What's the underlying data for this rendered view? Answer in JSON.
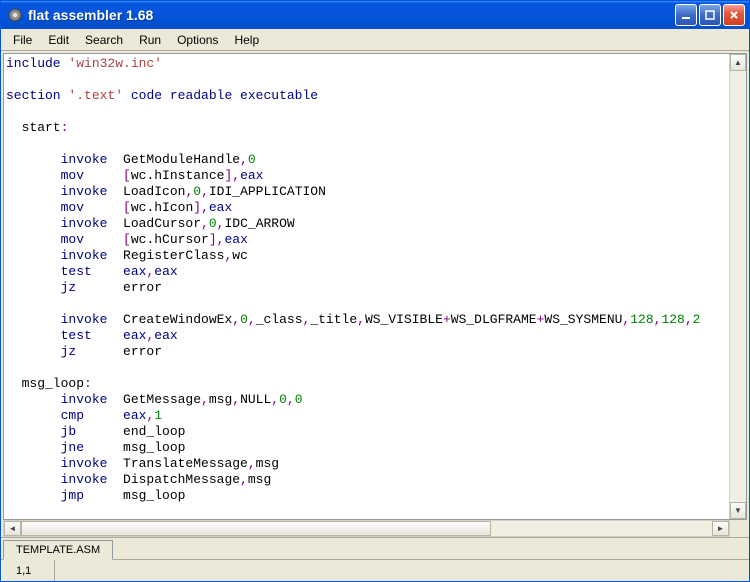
{
  "window": {
    "title": "flat assembler 1.68"
  },
  "menu": {
    "file": "File",
    "edit": "Edit",
    "search": "Search",
    "run": "Run",
    "options": "Options",
    "help": "Help"
  },
  "tab": {
    "filename": "TEMPLATE.ASM"
  },
  "status": {
    "position": "1,1"
  },
  "code": {
    "lines": [
      {
        "t": "kw",
        "v": "include "
      },
      {
        "t": "str",
        "v": "'win32w.inc'"
      },
      {
        "t": "nl"
      },
      {
        "t": "nl"
      },
      {
        "t": "kw",
        "v": "section "
      },
      {
        "t": "str",
        "v": "'.text' "
      },
      {
        "t": "kw",
        "v": "code readable executable"
      },
      {
        "t": "nl"
      },
      {
        "t": "nl"
      },
      {
        "t": "txt",
        "v": "  start"
      },
      {
        "t": "op",
        "v": ":"
      },
      {
        "t": "nl"
      },
      {
        "t": "nl"
      },
      {
        "t": "txt",
        "v": "       "
      },
      {
        "t": "kw",
        "v": "invoke"
      },
      {
        "t": "txt",
        "v": "  GetModuleHandle"
      },
      {
        "t": "op",
        "v": ","
      },
      {
        "t": "num",
        "v": "0"
      },
      {
        "t": "nl"
      },
      {
        "t": "txt",
        "v": "       "
      },
      {
        "t": "kw",
        "v": "mov"
      },
      {
        "t": "txt",
        "v": "     "
      },
      {
        "t": "op",
        "v": "["
      },
      {
        "t": "txt",
        "v": "wc.hInstance"
      },
      {
        "t": "op",
        "v": "],"
      },
      {
        "t": "kw",
        "v": "eax"
      },
      {
        "t": "nl"
      },
      {
        "t": "txt",
        "v": "       "
      },
      {
        "t": "kw",
        "v": "invoke"
      },
      {
        "t": "txt",
        "v": "  LoadIcon"
      },
      {
        "t": "op",
        "v": ","
      },
      {
        "t": "num",
        "v": "0"
      },
      {
        "t": "op",
        "v": ","
      },
      {
        "t": "txt",
        "v": "IDI_APPLICATION"
      },
      {
        "t": "nl"
      },
      {
        "t": "txt",
        "v": "       "
      },
      {
        "t": "kw",
        "v": "mov"
      },
      {
        "t": "txt",
        "v": "     "
      },
      {
        "t": "op",
        "v": "["
      },
      {
        "t": "txt",
        "v": "wc.hIcon"
      },
      {
        "t": "op",
        "v": "],"
      },
      {
        "t": "kw",
        "v": "eax"
      },
      {
        "t": "nl"
      },
      {
        "t": "txt",
        "v": "       "
      },
      {
        "t": "kw",
        "v": "invoke"
      },
      {
        "t": "txt",
        "v": "  LoadCursor"
      },
      {
        "t": "op",
        "v": ","
      },
      {
        "t": "num",
        "v": "0"
      },
      {
        "t": "op",
        "v": ","
      },
      {
        "t": "txt",
        "v": "IDC_ARROW"
      },
      {
        "t": "nl"
      },
      {
        "t": "txt",
        "v": "       "
      },
      {
        "t": "kw",
        "v": "mov"
      },
      {
        "t": "txt",
        "v": "     "
      },
      {
        "t": "op",
        "v": "["
      },
      {
        "t": "txt",
        "v": "wc.hCursor"
      },
      {
        "t": "op",
        "v": "],"
      },
      {
        "t": "kw",
        "v": "eax"
      },
      {
        "t": "nl"
      },
      {
        "t": "txt",
        "v": "       "
      },
      {
        "t": "kw",
        "v": "invoke"
      },
      {
        "t": "txt",
        "v": "  RegisterClass"
      },
      {
        "t": "op",
        "v": ","
      },
      {
        "t": "txt",
        "v": "wc"
      },
      {
        "t": "nl"
      },
      {
        "t": "txt",
        "v": "       "
      },
      {
        "t": "kw",
        "v": "test"
      },
      {
        "t": "txt",
        "v": "    "
      },
      {
        "t": "kw",
        "v": "eax"
      },
      {
        "t": "op",
        "v": ","
      },
      {
        "t": "kw",
        "v": "eax"
      },
      {
        "t": "nl"
      },
      {
        "t": "txt",
        "v": "       "
      },
      {
        "t": "kw",
        "v": "jz"
      },
      {
        "t": "txt",
        "v": "      error"
      },
      {
        "t": "nl"
      },
      {
        "t": "nl"
      },
      {
        "t": "txt",
        "v": "       "
      },
      {
        "t": "kw",
        "v": "invoke"
      },
      {
        "t": "txt",
        "v": "  CreateWindowEx"
      },
      {
        "t": "op",
        "v": ","
      },
      {
        "t": "num",
        "v": "0"
      },
      {
        "t": "op",
        "v": ","
      },
      {
        "t": "txt",
        "v": "_class"
      },
      {
        "t": "op",
        "v": ","
      },
      {
        "t": "txt",
        "v": "_title"
      },
      {
        "t": "op",
        "v": ","
      },
      {
        "t": "txt",
        "v": "WS_VISIBLE"
      },
      {
        "t": "op",
        "v": "+"
      },
      {
        "t": "txt",
        "v": "WS_DLGFRAME"
      },
      {
        "t": "op",
        "v": "+"
      },
      {
        "t": "txt",
        "v": "WS_SYSMENU"
      },
      {
        "t": "op",
        "v": ","
      },
      {
        "t": "num",
        "v": "128"
      },
      {
        "t": "op",
        "v": ","
      },
      {
        "t": "num",
        "v": "128"
      },
      {
        "t": "op",
        "v": ","
      },
      {
        "t": "num",
        "v": "2"
      },
      {
        "t": "nl"
      },
      {
        "t": "txt",
        "v": "       "
      },
      {
        "t": "kw",
        "v": "test"
      },
      {
        "t": "txt",
        "v": "    "
      },
      {
        "t": "kw",
        "v": "eax"
      },
      {
        "t": "op",
        "v": ","
      },
      {
        "t": "kw",
        "v": "eax"
      },
      {
        "t": "nl"
      },
      {
        "t": "txt",
        "v": "       "
      },
      {
        "t": "kw",
        "v": "jz"
      },
      {
        "t": "txt",
        "v": "      error"
      },
      {
        "t": "nl"
      },
      {
        "t": "nl"
      },
      {
        "t": "txt",
        "v": "  msg_loop"
      },
      {
        "t": "op",
        "v": ":"
      },
      {
        "t": "nl"
      },
      {
        "t": "txt",
        "v": "       "
      },
      {
        "t": "kw",
        "v": "invoke"
      },
      {
        "t": "txt",
        "v": "  GetMessage"
      },
      {
        "t": "op",
        "v": ","
      },
      {
        "t": "txt",
        "v": "msg"
      },
      {
        "t": "op",
        "v": ","
      },
      {
        "t": "txt",
        "v": "NULL"
      },
      {
        "t": "op",
        "v": ","
      },
      {
        "t": "num",
        "v": "0"
      },
      {
        "t": "op",
        "v": ","
      },
      {
        "t": "num",
        "v": "0"
      },
      {
        "t": "nl"
      },
      {
        "t": "txt",
        "v": "       "
      },
      {
        "t": "kw",
        "v": "cmp"
      },
      {
        "t": "txt",
        "v": "     "
      },
      {
        "t": "kw",
        "v": "eax"
      },
      {
        "t": "op",
        "v": ","
      },
      {
        "t": "num",
        "v": "1"
      },
      {
        "t": "nl"
      },
      {
        "t": "txt",
        "v": "       "
      },
      {
        "t": "kw",
        "v": "jb"
      },
      {
        "t": "txt",
        "v": "      end_loop"
      },
      {
        "t": "nl"
      },
      {
        "t": "txt",
        "v": "       "
      },
      {
        "t": "kw",
        "v": "jne"
      },
      {
        "t": "txt",
        "v": "     msg_loop"
      },
      {
        "t": "nl"
      },
      {
        "t": "txt",
        "v": "       "
      },
      {
        "t": "kw",
        "v": "invoke"
      },
      {
        "t": "txt",
        "v": "  TranslateMessage"
      },
      {
        "t": "op",
        "v": ","
      },
      {
        "t": "txt",
        "v": "msg"
      },
      {
        "t": "nl"
      },
      {
        "t": "txt",
        "v": "       "
      },
      {
        "t": "kw",
        "v": "invoke"
      },
      {
        "t": "txt",
        "v": "  DispatchMessage"
      },
      {
        "t": "op",
        "v": ","
      },
      {
        "t": "txt",
        "v": "msg"
      },
      {
        "t": "nl"
      },
      {
        "t": "txt",
        "v": "       "
      },
      {
        "t": "kw",
        "v": "jmp"
      },
      {
        "t": "txt",
        "v": "     msg_loop"
      },
      {
        "t": "nl"
      }
    ]
  }
}
